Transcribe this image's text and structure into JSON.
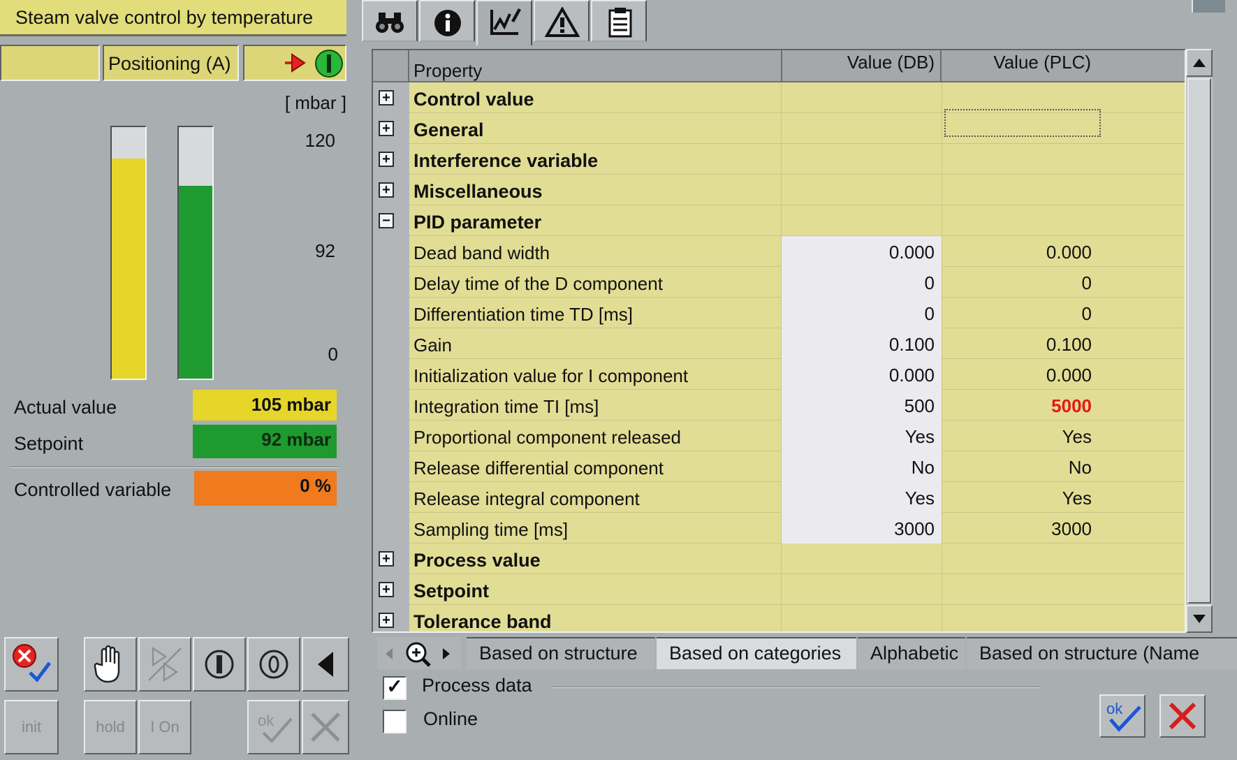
{
  "faceplate": {
    "title": "Steam valve control by temperature",
    "mode": "Positioning (A)",
    "unit": "[ mbar ]",
    "scale": {
      "max": "120",
      "mid": "92",
      "min": "0",
      "range": [
        0,
        120
      ]
    },
    "bars": {
      "actual": 105,
      "setpoint": 92
    },
    "actual_label": "Actual value",
    "actual_value": "105 mbar",
    "setpoint_label": "Setpoint",
    "setpoint_value": "92 mbar",
    "controlled_label": "Controlled variable",
    "controlled_value": "0 %",
    "buttons": {
      "init": "init",
      "hold": "hold",
      "ion": "I On",
      "ok": "ok"
    },
    "colors": {
      "actual": "#e6d62a",
      "setpoint": "#1f9a2e",
      "controlled": "#f07a1e",
      "status_red": "#e8221f",
      "green_ok": "#29b83a"
    }
  },
  "tabs": [
    "binoculars-icon",
    "info-icon",
    "trend-edit-icon",
    "warning-icon",
    "report-icon"
  ],
  "grid": {
    "headers": {
      "property": "Property",
      "db": "Value (DB)",
      "plc": "Value (PLC)"
    },
    "rows": [
      {
        "type": "category",
        "expanded": false,
        "name": "Control value"
      },
      {
        "type": "category",
        "expanded": false,
        "name": "General"
      },
      {
        "type": "category",
        "expanded": false,
        "name": "Interference variable"
      },
      {
        "type": "category",
        "expanded": false,
        "name": "Miscellaneous"
      },
      {
        "type": "category",
        "expanded": true,
        "name": "PID parameter"
      },
      {
        "type": "item",
        "name": "Dead band width",
        "db": "0.000",
        "plc": "0.000"
      },
      {
        "type": "item",
        "name": "Delay time of the D component",
        "db": "0",
        "plc": "0"
      },
      {
        "type": "item",
        "name": "Differentiation time TD [ms]",
        "db": "0",
        "plc": "0"
      },
      {
        "type": "item",
        "name": "Gain",
        "db": "0.100",
        "plc": "0.100"
      },
      {
        "type": "item",
        "name": "Initialization value for I component",
        "db": "0.000",
        "plc": "0.000"
      },
      {
        "type": "item",
        "name": "Integration time TI [ms]",
        "db": "500",
        "plc": "5000",
        "plc_differs": true
      },
      {
        "type": "item",
        "name": "Proportional component released",
        "db": "Yes",
        "plc": "Yes"
      },
      {
        "type": "item",
        "name": "Release differential component",
        "db": "No",
        "plc": "No"
      },
      {
        "type": "item",
        "name": "Release integral component",
        "db": "Yes",
        "plc": "Yes"
      },
      {
        "type": "item",
        "name": "Sampling time [ms]",
        "db": "3000",
        "plc": "3000"
      },
      {
        "type": "category",
        "expanded": false,
        "name": "Process value"
      },
      {
        "type": "category",
        "expanded": false,
        "name": "Setpoint"
      },
      {
        "type": "category",
        "expanded": false,
        "name": "Tolerance band"
      }
    ],
    "colors": {
      "differs": "#e0191c"
    }
  },
  "view_tabs": [
    "Based on structure",
    "Based on categories",
    "Alphabetic",
    "Based on structure (Name"
  ],
  "active_view_tab": 1,
  "options": {
    "process_data": {
      "label": "Process data",
      "checked": true
    },
    "online": {
      "label": "Online",
      "checked": false
    }
  },
  "dialog": {
    "ok": "ok"
  }
}
